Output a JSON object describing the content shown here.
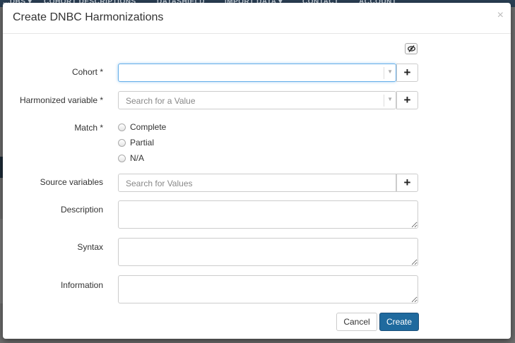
{
  "background": {
    "nav_items": [
      "...DBS ▾",
      "COHORT DESCRIPTIONS",
      "DATASHIELD",
      "IMPORT DATA ▾",
      "CONTACT",
      "ACCOUNT"
    ]
  },
  "modal": {
    "title": "Create DNBC Harmonizations",
    "close_symbol": "×",
    "fields": {
      "cohort": {
        "label": "Cohort *",
        "value": ""
      },
      "harmonized_variable": {
        "label": "Harmonized variable *",
        "placeholder": "Search for a Value"
      },
      "match": {
        "label": "Match *",
        "options": [
          "Complete",
          "Partial",
          "N/A"
        ]
      },
      "source_variables": {
        "label": "Source variables",
        "placeholder": "Search for Values"
      },
      "description": {
        "label": "Description"
      },
      "syntax": {
        "label": "Syntax"
      },
      "information": {
        "label": "Information"
      }
    },
    "plus_symbol": "+",
    "cancel_label": "Cancel",
    "create_label": "Create"
  },
  "colors": {
    "primary_button": "#1f6a9e",
    "focus_border": "#66afe9",
    "overlay": "#6e6e6e"
  }
}
